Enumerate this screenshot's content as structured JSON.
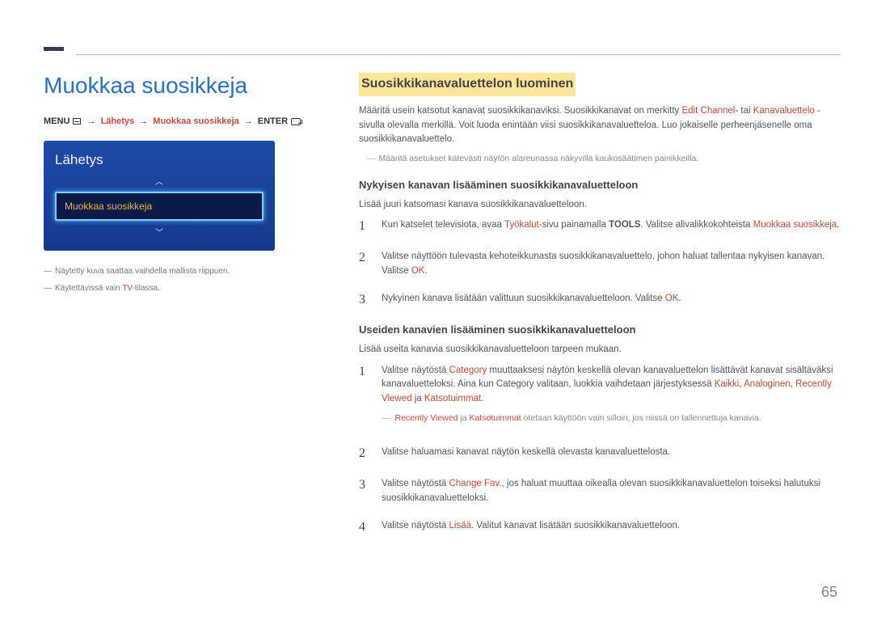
{
  "page_number": "65",
  "left": {
    "title": "Muokkaa suosikkeja",
    "breadcrumb": {
      "menu": "MENU",
      "path1": "Lähetys",
      "path2": "Muokkaa suosikkeja",
      "enter": "ENTER"
    },
    "panel": {
      "title": "Lähetys",
      "selected": "Muokkaa suosikkeja"
    },
    "footnotes": {
      "a": "Näytetty kuva saattaa vaihdella mallista riippuen.",
      "b_pre": "Käytettävissä vain ",
      "b_hl": "TV",
      "b_post": "-tilassa."
    }
  },
  "right": {
    "section_title": "Suosikkikanavaluettelon luominen",
    "intro_pre": "Määritä usein katsotut kanavat suosikkikanaviksi. Suosikkikanavat on merkitty ",
    "intro_hl1": "Edit Channel",
    "intro_mid": "- tai ",
    "intro_hl2": "Kanavaluettelo",
    "intro_post": " -sivulla olevalla merkillä. Voit luoda enintään viisi suosikkikanavaluetteloa. Luo jokaiselle perheenjäsenelle oma suosikkikanavaluettelo.",
    "intro_note": "Määritä asetukset kätevästi näytön alareunassa näkyvillä kaukosäätimen painikkeilla.",
    "sub1": {
      "head": "Nykyisen kanavan lisääminen suosikkikanavaluetteloon",
      "desc": "Lisää juuri katsomasi kanava suosikkikanavaluetteloon.",
      "steps": {
        "s1_a": "Kun katselet televisiota, avaa ",
        "s1_hl1": "Työkalut",
        "s1_b": "-sivu painamalla ",
        "s1_bold": "TOOLS",
        "s1_c": ". Valitse alivalikkokohteista ",
        "s1_hl2": "Muokkaa suosikkeja",
        "s1_d": ".",
        "s2_a": "Valitse näyttöön tulevasta kehoteikkunasta suosikkikanavaluettelo, johon haluat tallentaa nykyisen kanavan. Valitse ",
        "s2_hl": "OK",
        "s2_b": ".",
        "s3_a": "Nykyinen kanava lisätään valittuun suosikkikanavaluetteloon. Valitse ",
        "s3_hl": "OK",
        "s3_b": "."
      }
    },
    "sub2": {
      "head": "Useiden kanavien lisääminen suosikkikanavaluetteloon",
      "desc": "Lisää useita kanavia suosikkikanavaluetteloon tarpeen mukaan.",
      "steps": {
        "s1_a": "Valitse näytöstä ",
        "s1_hl1": "Category",
        "s1_b": " muuttaaksesi näytön keskellä olevan kanavaluettelon lisättävät kanavat sisältäväksi kanavaluetteloksi. Aina kun Category valitaan, luokkia vaihdetaan järjestyksessä ",
        "s1_hl2": "Kaikki",
        "s1_c": ", ",
        "s1_hl3": "Analoginen",
        "s1_d": ", ",
        "s1_hl4": "Recently Viewed",
        "s1_e": " ja ",
        "s1_hl5": "Katsotuimmat",
        "s1_f": ".",
        "note_a": "Recently Viewed",
        "note_mid": " ja ",
        "note_b": "Katsotuimmat",
        "note_post": " otetaan käyttöön vain silloin, jos niissä on tallennettuja kanavia.",
        "s2": "Valitse haluamasi kanavat näytön keskellä olevasta kanavaluettelosta.",
        "s3_a": "Valitse näytöstä ",
        "s3_hl": "Change Fav.",
        "s3_b": ", jos haluat muuttaa oikealla olevan suosikkikanavaluettelon toiseksi halutuksi suosikkikanavaluetteloksi.",
        "s4_a": "Valitse näytöstä ",
        "s4_hl": "Lisää",
        "s4_b": ". Valitut kanavat lisätään suosikkikanavaluetteloon."
      }
    }
  }
}
